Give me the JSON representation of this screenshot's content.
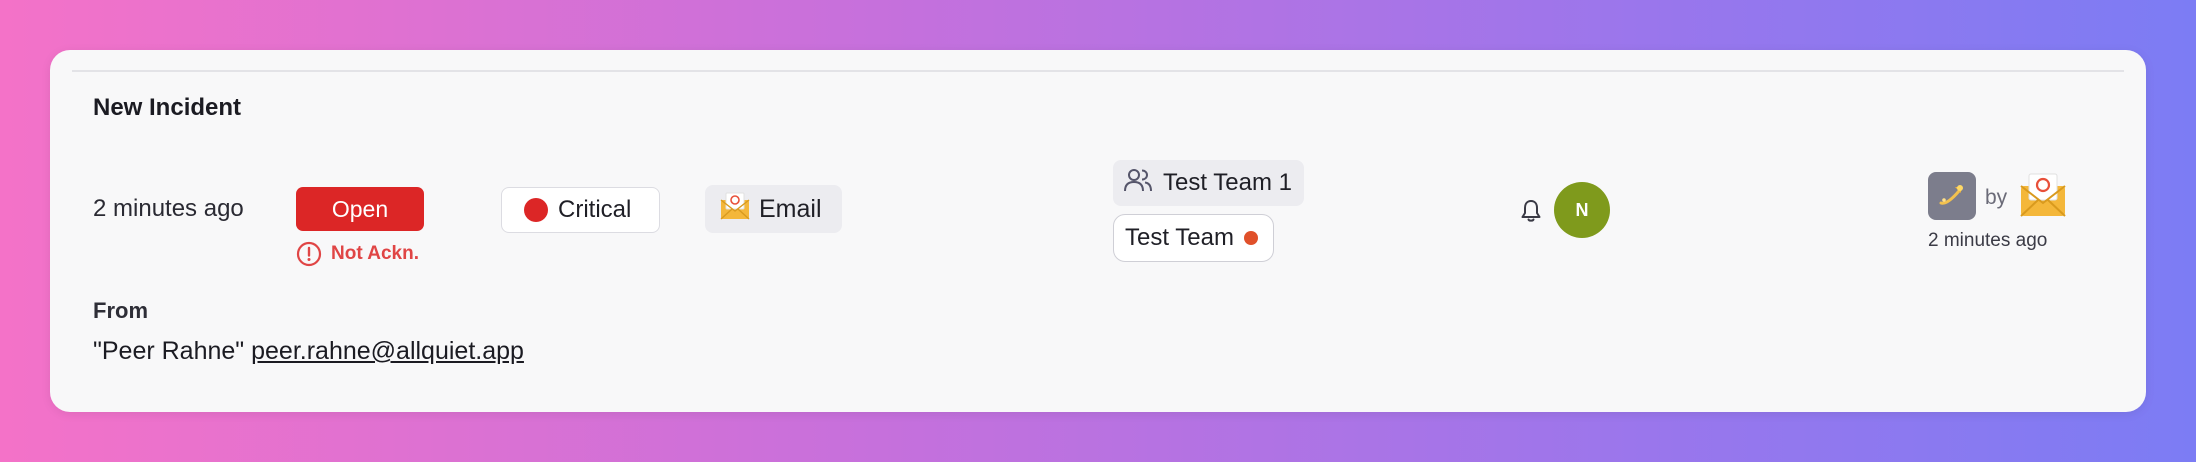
{
  "incident": {
    "title": "New Incident",
    "created_relative": "2 minutes ago",
    "status_label": "Open",
    "ack_status": "Not Ackn.",
    "severity_label": "Critical",
    "severity_color": "#dc2626",
    "status_color": "#dc2626",
    "source_label": "Email",
    "source_icon": "envelope-icon",
    "teams": [
      {
        "label": "Test Team 1",
        "icon": "users-icon"
      },
      {
        "label": "Test Team",
        "status_dot_color": "#e0502a"
      }
    ],
    "assignee_initial": "N",
    "assignee_color": "#7f9a1c",
    "by_label": "by",
    "updated_relative": "2 minutes ago",
    "from_label": "From",
    "from_name": "\"Peer Rahne\"",
    "from_email": "peer.rahne@allquiet.app"
  }
}
